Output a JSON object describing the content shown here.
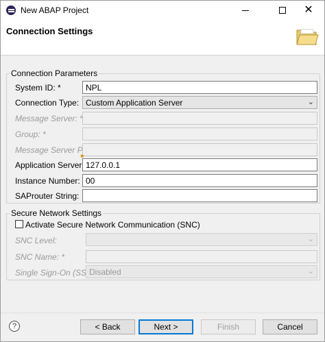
{
  "window": {
    "title": "New ABAP Project",
    "minimize_icon": "minimize-icon",
    "maximize_icon": "maximize-icon",
    "close_icon": "close-icon",
    "close_glyph": "✕"
  },
  "banner": {
    "title": "Connection Settings",
    "icon": "folder-icon"
  },
  "connection": {
    "legend": "Connection Parameters",
    "system_id_label": "System ID: *",
    "system_id_value": "NPL",
    "connection_type_label": "Connection Type:",
    "connection_type_value": "Custom Application Server",
    "message_server_label": "Message Server: *",
    "message_server_value": "",
    "group_label": "Group: *",
    "group_value": "",
    "message_server_port_label": "Message Server Port:",
    "message_server_port_value": "",
    "app_server_label": "Application Server: *",
    "app_server_value": "127.0.0.1",
    "instance_number_label": "Instance Number: *",
    "instance_number_value": "00",
    "saprouter_label": "SAProuter String:",
    "saprouter_value": ""
  },
  "secure": {
    "legend": "Secure Network Settings",
    "activate_snc_label": "Activate Secure Network Communication (SNC)",
    "activate_snc_checked": false,
    "snc_level_label": "SNC Level:",
    "snc_level_value": "",
    "snc_name_label": "SNC Name: *",
    "snc_name_value": "",
    "sso_label": "Single Sign-On (SSO):",
    "sso_value": "Disabled"
  },
  "footer": {
    "help_glyph": "?",
    "back_label": "< Back",
    "next_label": "Next >",
    "finish_label": "Finish",
    "cancel_label": "Cancel"
  }
}
